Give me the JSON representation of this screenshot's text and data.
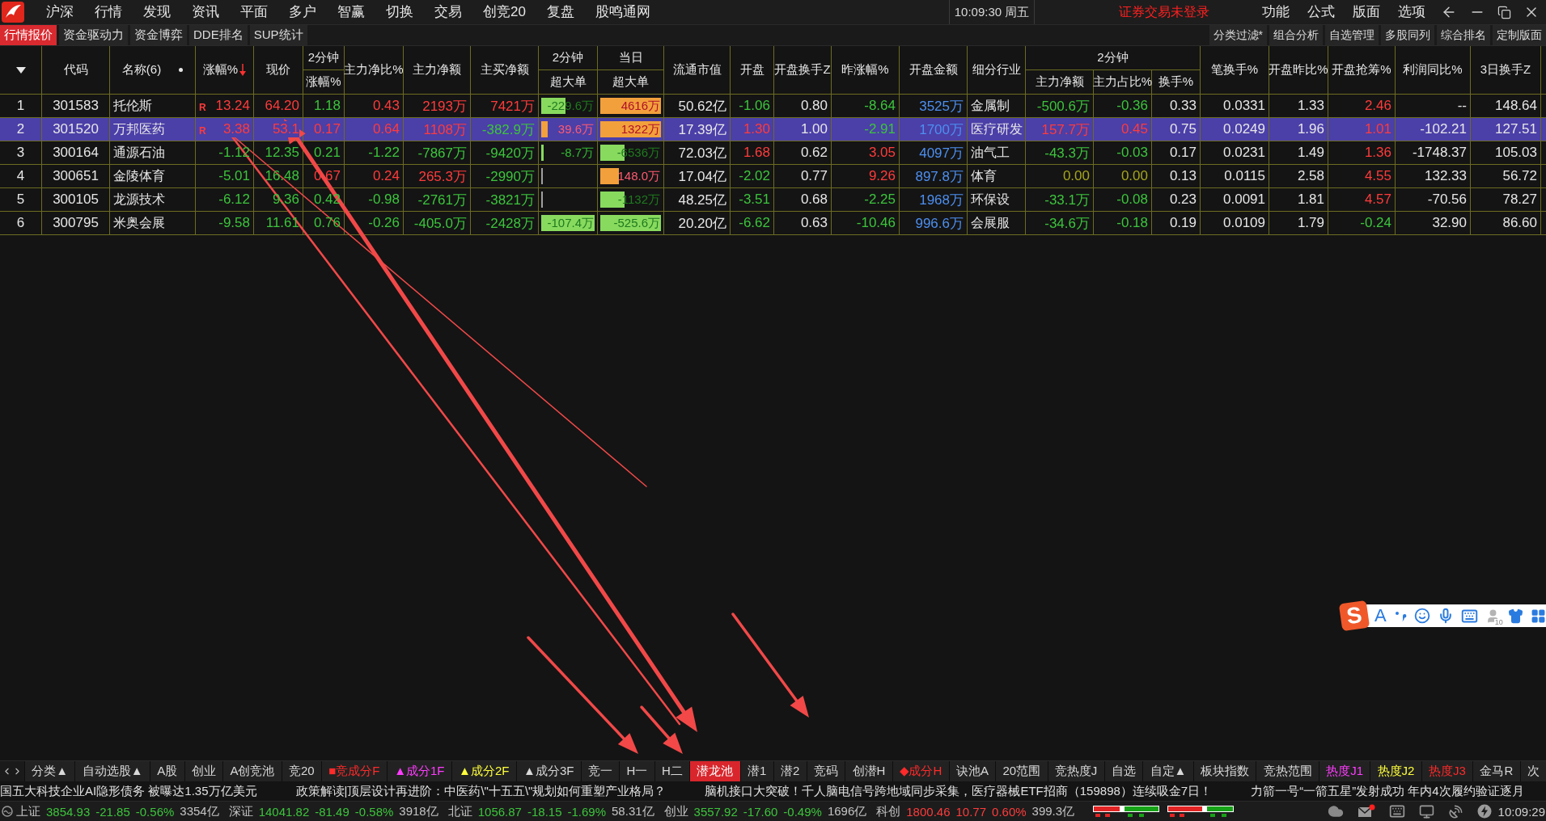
{
  "menu_bar": {
    "items": [
      "沪深",
      "行情",
      "发现",
      "资讯",
      "平面",
      "多户",
      "智赢",
      "切换",
      "交易",
      "创竞20",
      "复盘",
      "股鸣通网"
    ],
    "clock": "10:09:30 周五",
    "login_status": "证券交易未登录",
    "right_items": [
      "功能",
      "公式",
      "版面",
      "选项"
    ]
  },
  "view_tabs": [
    {
      "label": "行情报价",
      "selected": true
    },
    {
      "label": "资金驱动力",
      "selected": false
    },
    {
      "label": "资金博弈",
      "selected": false
    },
    {
      "label": "DDE排名",
      "selected": false
    },
    {
      "label": "SUP统计",
      "selected": false
    }
  ],
  "tool_buttons": [
    "分类过滤*",
    "组合分析",
    "自选管理",
    "多股同列",
    "综合排名",
    "定制版面"
  ],
  "table": {
    "header": [
      {
        "kind": "column",
        "label": "代码",
        "sorted": false
      },
      {
        "kind": "column",
        "label": "名称(6)",
        "sorted": false
      },
      {
        "kind": "column",
        "label": "涨幅%",
        "sorted": true
      },
      {
        "kind": "column",
        "label": "现价",
        "sorted": false
      },
      {
        "kind": "group",
        "group": "2分钟",
        "columns": [
          "涨幅%"
        ]
      },
      {
        "kind": "column",
        "label": "主力净比%",
        "sorted": false
      },
      {
        "kind": "column",
        "label": "主力净额",
        "sorted": false
      },
      {
        "kind": "column",
        "label": "主买净额",
        "sorted": false
      },
      {
        "kind": "group",
        "group": "2分钟",
        "columns": [
          "超大单"
        ]
      },
      {
        "kind": "group",
        "group": "当日",
        "columns": [
          "超大单"
        ]
      },
      {
        "kind": "column",
        "label": "流通市值",
        "sorted": false
      },
      {
        "kind": "column",
        "label": "开盘",
        "sorted": false
      },
      {
        "kind": "column",
        "label": "开盘换手Z",
        "sorted": false
      },
      {
        "kind": "column",
        "label": "昨涨幅%",
        "sorted": false
      },
      {
        "kind": "column",
        "label": "开盘金额",
        "sorted": false
      },
      {
        "kind": "column",
        "label": "细分行业",
        "sorted": false
      },
      {
        "kind": "group",
        "group": "2分钟",
        "columns": [
          "主力净额",
          "主力占比%",
          "换手%"
        ]
      },
      {
        "kind": "column",
        "label": "笔换手%",
        "sorted": false
      },
      {
        "kind": "column",
        "label": "开盘昨比%",
        "sorted": false
      },
      {
        "kind": "column",
        "label": "开盘抢筹%",
        "sorted": false
      },
      {
        "kind": "column",
        "label": "利润同比%",
        "sorted": false
      },
      {
        "kind": "column",
        "label": "3日换手Z",
        "sorted": false
      }
    ],
    "rows": [
      {
        "index": "1",
        "selected": false,
        "cells": [
          {
            "kind": "code",
            "text": "301583"
          },
          {
            "kind": "label",
            "text": "托伦斯"
          },
          {
            "kind": "number",
            "text": "13.24",
            "color": "#ff3b3b",
            "flag": "R"
          },
          {
            "kind": "number",
            "text": "64.20",
            "color": "#ff3b3b"
          },
          {
            "kind": "number",
            "text": "1.18",
            "color": "#3cc43c"
          },
          {
            "kind": "number",
            "text": "0.43",
            "color": "#ff3b3b"
          },
          {
            "kind": "number",
            "text": "2193万",
            "color": "#ff3b3b"
          },
          {
            "kind": "number",
            "text": "7421万",
            "color": "#ff3b3b"
          },
          {
            "kind": "bar",
            "text": "-229.6万",
            "positive": false,
            "level": 0.45
          },
          {
            "kind": "bar",
            "text": "4616万",
            "positive": true,
            "level": 1
          },
          {
            "kind": "number",
            "text": "50.62亿",
            "color": "#e6e6e6"
          },
          {
            "kind": "number",
            "text": "-1.06",
            "color": "#3cc43c"
          },
          {
            "kind": "number",
            "text": "0.80",
            "color": "#e6e6e6"
          },
          {
            "kind": "number",
            "text": "-8.64",
            "color": "#3cc43c"
          },
          {
            "kind": "number",
            "text": "3525万",
            "color": "#4d8ff0"
          },
          {
            "kind": "label",
            "text": "金属制"
          },
          {
            "kind": "number",
            "text": "-500.6万",
            "color": "#3cc43c"
          },
          {
            "kind": "number",
            "text": "-0.36",
            "color": "#3cc43c"
          },
          {
            "kind": "number",
            "text": "0.33",
            "color": "#e6e6e6"
          },
          {
            "kind": "number",
            "text": "0.0331",
            "color": "#e6e6e6"
          },
          {
            "kind": "number",
            "text": "1.33",
            "color": "#e6e6e6"
          },
          {
            "kind": "number",
            "text": "2.46",
            "color": "#ff3b3b"
          },
          {
            "kind": "number",
            "text": "--",
            "color": "#e6e6e6"
          },
          {
            "kind": "number",
            "text": "148.64",
            "color": "#e6e6e6"
          }
        ]
      },
      {
        "index": "2",
        "selected": true,
        "cells": [
          {
            "kind": "code",
            "text": "301520"
          },
          {
            "kind": "label",
            "text": "万邦医药"
          },
          {
            "kind": "number",
            "text": "3.38",
            "color": "#ff3b3b",
            "flag": "R"
          },
          {
            "kind": "number",
            "text": "53.1",
            "color": "#ff3b3b"
          },
          {
            "kind": "number",
            "text": "0.17",
            "color": "#ff3b3b"
          },
          {
            "kind": "number",
            "text": "0.64",
            "color": "#ff3b3b"
          },
          {
            "kind": "number",
            "text": "1108万",
            "color": "#ff3b3b"
          },
          {
            "kind": "number",
            "text": "-382.9万",
            "color": "#3cc43c"
          },
          {
            "kind": "bar",
            "text": "39.6万",
            "positive": true,
            "level": 0.12
          },
          {
            "kind": "bar",
            "text": "1322万",
            "positive": true,
            "level": 1
          },
          {
            "kind": "number",
            "text": "17.39亿",
            "color": "#e6e6e6"
          },
          {
            "kind": "number",
            "text": "1.30",
            "color": "#ff3b3b"
          },
          {
            "kind": "number",
            "text": "1.00",
            "color": "#e6e6e6"
          },
          {
            "kind": "number",
            "text": "-2.91",
            "color": "#3cc43c"
          },
          {
            "kind": "number",
            "text": "1700万",
            "color": "#4d8ff0"
          },
          {
            "kind": "label",
            "text": "医疗研发"
          },
          {
            "kind": "number",
            "text": "157.7万",
            "color": "#ff3b3b"
          },
          {
            "kind": "number",
            "text": "0.45",
            "color": "#ff3b3b"
          },
          {
            "kind": "number",
            "text": "0.75",
            "color": "#e6e6e6"
          },
          {
            "kind": "number",
            "text": "0.0249",
            "color": "#e6e6e6"
          },
          {
            "kind": "number",
            "text": "1.96",
            "color": "#e6e6e6"
          },
          {
            "kind": "number",
            "text": "1.01",
            "color": "#ff3b3b"
          },
          {
            "kind": "number",
            "text": "-102.21",
            "color": "#e6e6e6"
          },
          {
            "kind": "number",
            "text": "127.51",
            "color": "#e6e6e6"
          }
        ]
      },
      {
        "index": "3",
        "selected": false,
        "cells": [
          {
            "kind": "code",
            "text": "300164"
          },
          {
            "kind": "label",
            "text": "通源石油"
          },
          {
            "kind": "number",
            "text": "-1.12",
            "color": "#3cc43c"
          },
          {
            "kind": "number",
            "text": "12.35",
            "color": "#3cc43c"
          },
          {
            "kind": "number",
            "text": "0.21",
            "color": "#3cc43c"
          },
          {
            "kind": "number",
            "text": "-1.22",
            "color": "#3cc43c"
          },
          {
            "kind": "number",
            "text": "-7867万",
            "color": "#3cc43c"
          },
          {
            "kind": "number",
            "text": "-9420万",
            "color": "#3cc43c"
          },
          {
            "kind": "bar",
            "text": "-8.7万",
            "positive": false,
            "level": 0.05
          },
          {
            "kind": "bar",
            "text": "-6536万",
            "positive": false,
            "level": 0.4
          },
          {
            "kind": "number",
            "text": "72.03亿",
            "color": "#e6e6e6"
          },
          {
            "kind": "number",
            "text": "1.68",
            "color": "#ff3b3b"
          },
          {
            "kind": "number",
            "text": "0.62",
            "color": "#e6e6e6"
          },
          {
            "kind": "number",
            "text": "3.05",
            "color": "#ff3b3b"
          },
          {
            "kind": "number",
            "text": "4097万",
            "color": "#4d8ff0"
          },
          {
            "kind": "label",
            "text": "油气工"
          },
          {
            "kind": "number",
            "text": "-43.3万",
            "color": "#3cc43c"
          },
          {
            "kind": "number",
            "text": "-0.03",
            "color": "#3cc43c"
          },
          {
            "kind": "number",
            "text": "0.17",
            "color": "#e6e6e6"
          },
          {
            "kind": "number",
            "text": "0.0231",
            "color": "#e6e6e6"
          },
          {
            "kind": "number",
            "text": "1.49",
            "color": "#e6e6e6"
          },
          {
            "kind": "number",
            "text": "1.36",
            "color": "#ff3b3b"
          },
          {
            "kind": "number",
            "text": "-1748.37",
            "color": "#e6e6e6"
          },
          {
            "kind": "number",
            "text": "105.03",
            "color": "#e6e6e6"
          }
        ]
      },
      {
        "index": "4",
        "selected": false,
        "cells": [
          {
            "kind": "code",
            "text": "300651"
          },
          {
            "kind": "label",
            "text": "金陵体育"
          },
          {
            "kind": "number",
            "text": "-5.01",
            "color": "#3cc43c"
          },
          {
            "kind": "number",
            "text": "16.48",
            "color": "#3cc43c"
          },
          {
            "kind": "number",
            "text": "0.67",
            "color": "#ff3b3b"
          },
          {
            "kind": "number",
            "text": "0.24",
            "color": "#ff3b3b"
          },
          {
            "kind": "number",
            "text": "265.3万",
            "color": "#ff3b3b"
          },
          {
            "kind": "number",
            "text": "-2990万",
            "color": "#3cc43c"
          },
          {
            "kind": "bar",
            "level": 0
          },
          {
            "kind": "bar",
            "text": "148.0万",
            "positive": true,
            "level": 0.3
          },
          {
            "kind": "number",
            "text": "17.04亿",
            "color": "#e6e6e6"
          },
          {
            "kind": "number",
            "text": "-2.02",
            "color": "#3cc43c"
          },
          {
            "kind": "number",
            "text": "0.77",
            "color": "#e6e6e6"
          },
          {
            "kind": "number",
            "text": "9.26",
            "color": "#ff3b3b"
          },
          {
            "kind": "number",
            "text": "897.8万",
            "color": "#4d8ff0"
          },
          {
            "kind": "label",
            "text": "体育"
          },
          {
            "kind": "number",
            "text": "0.00",
            "color": "#a6a61c"
          },
          {
            "kind": "number",
            "text": "0.00",
            "color": "#a6a61c"
          },
          {
            "kind": "number",
            "text": "0.13",
            "color": "#e6e6e6"
          },
          {
            "kind": "number",
            "text": "0.0115",
            "color": "#e6e6e6"
          },
          {
            "kind": "number",
            "text": "2.58",
            "color": "#e6e6e6"
          },
          {
            "kind": "number",
            "text": "4.55",
            "color": "#ff3b3b"
          },
          {
            "kind": "number",
            "text": "132.33",
            "color": "#e6e6e6"
          },
          {
            "kind": "number",
            "text": "56.72",
            "color": "#e6e6e6"
          }
        ]
      },
      {
        "index": "5",
        "selected": false,
        "cells": [
          {
            "kind": "code",
            "text": "300105"
          },
          {
            "kind": "label",
            "text": "龙源技术"
          },
          {
            "kind": "number",
            "text": "-6.12",
            "color": "#3cc43c"
          },
          {
            "kind": "number",
            "text": "9.36",
            "color": "#3cc43c"
          },
          {
            "kind": "number",
            "text": "0.42",
            "color": "#3cc43c"
          },
          {
            "kind": "number",
            "text": "-0.98",
            "color": "#3cc43c"
          },
          {
            "kind": "number",
            "text": "-2761万",
            "color": "#3cc43c"
          },
          {
            "kind": "number",
            "text": "-3821万",
            "color": "#3cc43c"
          },
          {
            "kind": "bar",
            "level": 0
          },
          {
            "kind": "bar",
            "text": "-1132万",
            "positive": false,
            "level": 0.4
          },
          {
            "kind": "number",
            "text": "48.25亿",
            "color": "#e6e6e6"
          },
          {
            "kind": "number",
            "text": "-3.51",
            "color": "#3cc43c"
          },
          {
            "kind": "number",
            "text": "0.68",
            "color": "#e6e6e6"
          },
          {
            "kind": "number",
            "text": "-2.25",
            "color": "#3cc43c"
          },
          {
            "kind": "number",
            "text": "1968万",
            "color": "#4d8ff0"
          },
          {
            "kind": "label",
            "text": "环保设"
          },
          {
            "kind": "number",
            "text": "-33.1万",
            "color": "#3cc43c"
          },
          {
            "kind": "number",
            "text": "-0.08",
            "color": "#3cc43c"
          },
          {
            "kind": "number",
            "text": "0.23",
            "color": "#e6e6e6"
          },
          {
            "kind": "number",
            "text": "0.0091",
            "color": "#e6e6e6"
          },
          {
            "kind": "number",
            "text": "1.81",
            "color": "#e6e6e6"
          },
          {
            "kind": "number",
            "text": "4.57",
            "color": "#ff3b3b"
          },
          {
            "kind": "number",
            "text": "-70.56",
            "color": "#e6e6e6"
          },
          {
            "kind": "number",
            "text": "78.27",
            "color": "#e6e6e6"
          }
        ]
      },
      {
        "index": "6",
        "selected": false,
        "cells": [
          {
            "kind": "code",
            "text": "300795"
          },
          {
            "kind": "label",
            "text": "米奥会展"
          },
          {
            "kind": "number",
            "text": "-9.58",
            "color": "#3cc43c"
          },
          {
            "kind": "number",
            "text": "11.61",
            "color": "#3cc43c"
          },
          {
            "kind": "number",
            "text": "0.76",
            "color": "#3cc43c"
          },
          {
            "kind": "number",
            "text": "-0.26",
            "color": "#3cc43c"
          },
          {
            "kind": "number",
            "text": "-405.0万",
            "color": "#3cc43c"
          },
          {
            "kind": "number",
            "text": "-2428万",
            "color": "#3cc43c"
          },
          {
            "kind": "bar",
            "text": "-107.4万",
            "positive": false,
            "level": 1
          },
          {
            "kind": "bar",
            "text": "-525.6万",
            "positive": false,
            "level": 1
          },
          {
            "kind": "number",
            "text": "20.20亿",
            "color": "#e6e6e6"
          },
          {
            "kind": "number",
            "text": "-6.62",
            "color": "#3cc43c"
          },
          {
            "kind": "number",
            "text": "0.63",
            "color": "#e6e6e6"
          },
          {
            "kind": "number",
            "text": "-10.46",
            "color": "#3cc43c"
          },
          {
            "kind": "number",
            "text": "996.6万",
            "color": "#4d8ff0"
          },
          {
            "kind": "label",
            "text": "会展服"
          },
          {
            "kind": "number",
            "text": "-34.6万",
            "color": "#3cc43c"
          },
          {
            "kind": "number",
            "text": "-0.18",
            "color": "#3cc43c"
          },
          {
            "kind": "number",
            "text": "0.19",
            "color": "#e6e6e6"
          },
          {
            "kind": "number",
            "text": "0.0109",
            "color": "#e6e6e6"
          },
          {
            "kind": "number",
            "text": "1.79",
            "color": "#e6e6e6"
          },
          {
            "kind": "number",
            "text": "-0.24",
            "color": "#3cc43c"
          },
          {
            "kind": "number",
            "text": "32.90",
            "color": "#e6e6e6"
          },
          {
            "kind": "number",
            "text": "86.60",
            "color": "#e6e6e6"
          }
        ]
      }
    ]
  },
  "ime_toolbar": {
    "logo": "S",
    "mode": "A",
    "badge": "10"
  },
  "bottom_tabs": [
    {
      "label": "分类▲",
      "selected": false
    },
    {
      "label": "自动选股▲",
      "selected": false
    },
    {
      "label": "A股",
      "selected": false
    },
    {
      "label": "创业",
      "selected": false
    },
    {
      "label": "A创竞池",
      "selected": false
    },
    {
      "label": "竞20",
      "selected": false
    },
    {
      "label": "■竞成分F",
      "selected": false,
      "color": "#ff2a2a"
    },
    {
      "label": "▲成分1F",
      "selected": false,
      "color": "#ff3cff"
    },
    {
      "label": "▲成分2F",
      "selected": false,
      "color": "#ffff3c"
    },
    {
      "label": "▲成分3F",
      "selected": false
    },
    {
      "label": "竞一",
      "selected": false
    },
    {
      "label": "H一",
      "selected": false
    },
    {
      "label": "H二",
      "selected": false
    },
    {
      "label": "潜龙池",
      "selected": true
    },
    {
      "label": "潜1",
      "selected": false
    },
    {
      "label": "潜2",
      "selected": false
    },
    {
      "label": "竞码",
      "selected": false
    },
    {
      "label": "创潜H",
      "selected": false
    },
    {
      "label": "◆成分H",
      "selected": false,
      "color": "#ff2a2a"
    },
    {
      "label": "诀池A",
      "selected": false
    },
    {
      "label": "20范围",
      "selected": false
    },
    {
      "label": "竞热度J",
      "selected": false
    },
    {
      "label": "自选",
      "selected": false
    },
    {
      "label": "自定▲",
      "selected": false
    },
    {
      "label": "板块指数",
      "selected": false
    },
    {
      "label": "竞热范围",
      "selected": false
    },
    {
      "label": "热度J1",
      "selected": false,
      "color": "#ff3cff"
    },
    {
      "label": "热度J2",
      "selected": false,
      "color": "#ffff3c"
    },
    {
      "label": "热度J3",
      "selected": false,
      "color": "#ff2a2a"
    },
    {
      "label": "金马R",
      "selected": false
    },
    {
      "label": "次",
      "selected": false
    }
  ],
  "news_ticker": [
    "国五大科技企业AI隐形债务 被曝达1.35万亿美元",
    "政策解读|顶层设计再进阶：中医药\\\"十五五\\\"规划如何重塑产业格局？",
    "脑机接口大突破！千人脑电信号跨地域同步采集，医疗器械ETF招商（159898）连续吸金7日！",
    "力箭一号“一箭五星”发射成功 年内4次履约验证逐月"
  ],
  "index_bar": {
    "indices": [
      {
        "name": "上证",
        "value": "3854.93",
        "change": "-21.85",
        "pct": "-0.56%",
        "volume": "3354亿",
        "rising": false
      },
      {
        "name": "深证",
        "value": "14041.82",
        "change": "-81.49",
        "pct": "-0.58%",
        "volume": "3918亿",
        "rising": false
      },
      {
        "name": "北证",
        "value": "1056.87",
        "change": "-18.15",
        "pct": "-1.69%",
        "volume": "58.31亿",
        "rising": false
      },
      {
        "name": "创业",
        "value": "3557.92",
        "change": "-17.60",
        "pct": "-0.49%",
        "volume": "1696亿",
        "rising": false
      },
      {
        "name": "科创",
        "value": "1800.46",
        "change": "10.77",
        "pct": "0.60%",
        "volume": "399.3亿",
        "rising": true
      }
    ],
    "time": "10:09:29"
  }
}
